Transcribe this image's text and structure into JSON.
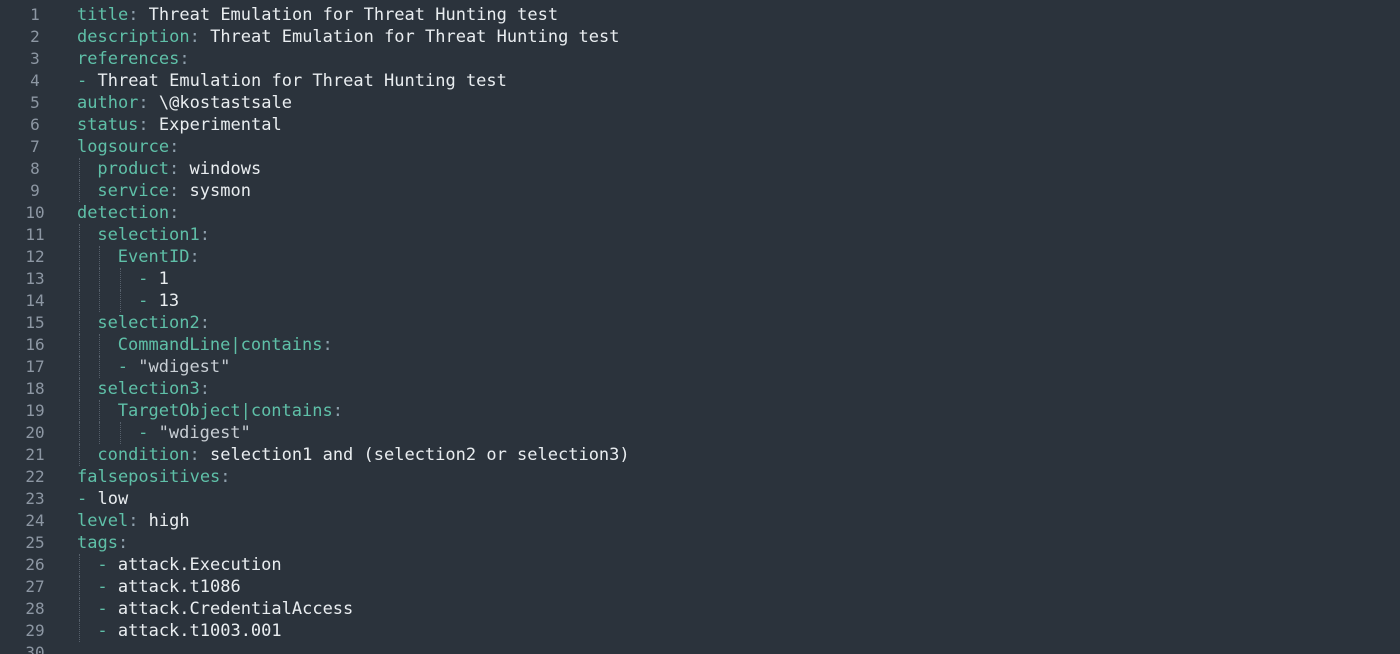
{
  "editor": {
    "line_numbers": [
      "1",
      "2",
      "3",
      "4",
      "5",
      "6",
      "7",
      "8",
      "9",
      "10",
      "11",
      "12",
      "13",
      "14",
      "15",
      "16",
      "17",
      "18",
      "19",
      "20",
      "21",
      "22",
      "23",
      "24",
      "25",
      "26",
      "27",
      "28",
      "29",
      "30"
    ],
    "lines": [
      {
        "indent": 0,
        "key": "title",
        "value": "Threat Emulation for Threat Hunting test"
      },
      {
        "indent": 0,
        "key": "description",
        "value": "Threat Emulation for Threat Hunting test"
      },
      {
        "indent": 0,
        "key": "references",
        "value": ""
      },
      {
        "indent": 0,
        "dash": true,
        "value": "Threat Emulation for Threat Hunting test"
      },
      {
        "indent": 0,
        "key": "author",
        "value": "\\@kostastsale"
      },
      {
        "indent": 0,
        "key": "status",
        "value": "Experimental"
      },
      {
        "indent": 0,
        "key": "logsource",
        "value": ""
      },
      {
        "indent": 1,
        "key": "product",
        "value": "windows"
      },
      {
        "indent": 1,
        "key": "service",
        "value": "sysmon"
      },
      {
        "indent": 0,
        "key": "detection",
        "value": ""
      },
      {
        "indent": 1,
        "key": "selection1",
        "value": ""
      },
      {
        "indent": 2,
        "key": "EventID",
        "value": ""
      },
      {
        "indent": 3,
        "dash": true,
        "value": "1"
      },
      {
        "indent": 3,
        "dash": true,
        "value": "13"
      },
      {
        "indent": 1,
        "key": "selection2",
        "value": ""
      },
      {
        "indent": 2,
        "key": "CommandLine|contains",
        "value": ""
      },
      {
        "indent": 2,
        "dash": true,
        "value": "\"wdigest\"",
        "string": true
      },
      {
        "indent": 1,
        "key": "selection3",
        "value": ""
      },
      {
        "indent": 2,
        "key": "TargetObject|contains",
        "value": ""
      },
      {
        "indent": 3,
        "dash": true,
        "value": "\"wdigest\"",
        "string": true
      },
      {
        "indent": 1,
        "key": "condition",
        "value": "selection1 and (selection2 or selection3)"
      },
      {
        "indent": 0,
        "key": "falsepositives",
        "value": ""
      },
      {
        "indent": 0,
        "dash": true,
        "value": "low"
      },
      {
        "indent": 0,
        "key": "level",
        "value": "high"
      },
      {
        "indent": 0,
        "key": "tags",
        "value": ""
      },
      {
        "indent": 1,
        "dash": true,
        "value": "attack.Execution"
      },
      {
        "indent": 1,
        "dash": true,
        "value": "attack.t1086"
      },
      {
        "indent": 1,
        "dash": true,
        "value": "attack.CredentialAccess"
      },
      {
        "indent": 1,
        "dash": true,
        "value": "attack.t1003.001"
      },
      {
        "indent": 0,
        "value": ""
      }
    ]
  },
  "colors": {
    "background": "#2b333c",
    "key": "#5fc0a8",
    "value": "#e9edf0",
    "line_number": "#8d97a3"
  }
}
